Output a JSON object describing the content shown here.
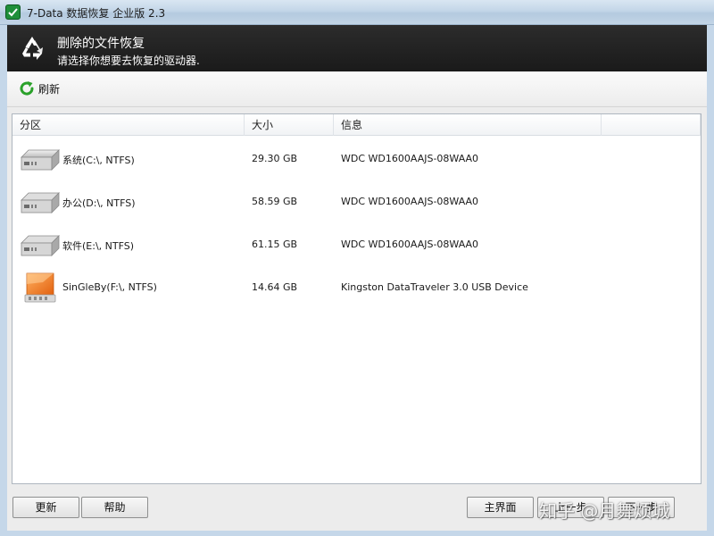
{
  "window": {
    "title": "7-Data 数据恢复 企业版 2.3",
    "icon": "app-logo-icon"
  },
  "header": {
    "icon": "recycle-icon",
    "title": "删除的文件恢复",
    "subtitle": "请选择你想要去恢复的驱动器."
  },
  "toolbar": {
    "refresh_icon": "refresh-icon",
    "refresh_label": "刷新"
  },
  "table": {
    "columns": [
      "分区",
      "大小",
      "信息",
      ""
    ],
    "rows": [
      {
        "icon": "hard-drive-icon",
        "name": "系统(C:\\, NTFS)",
        "size": "29.30 GB",
        "info": "WDC WD1600AAJS-08WAA0"
      },
      {
        "icon": "hard-drive-icon",
        "name": "办公(D:\\, NTFS)",
        "size": "58.59 GB",
        "info": "WDC WD1600AAJS-08WAA0"
      },
      {
        "icon": "hard-drive-icon",
        "name": "软件(E:\\, NTFS)",
        "size": "61.15 GB",
        "info": "WDC WD1600AAJS-08WAA0"
      },
      {
        "icon": "usb-drive-icon",
        "name": "SinGleBy(F:\\, NTFS)",
        "size": "14.64 GB",
        "info": "Kingston DataTraveler 3.0 USB Device"
      }
    ]
  },
  "footer": {
    "update_label": "更新",
    "help_label": "帮助",
    "main_label": "主界面",
    "back_label": "上一步",
    "next_label": "下一步"
  },
  "watermark": "知乎 @月舞烦城",
  "colors": {
    "header_bg": "#1f1f1f",
    "refresh_green": "#2aa12a",
    "usb_orange": "#f07a1e",
    "content_bg": "#ececec"
  }
}
